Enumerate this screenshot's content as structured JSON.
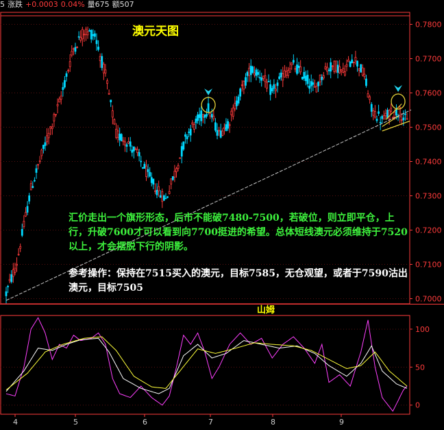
{
  "topbar": {
    "prefix": "5",
    "change_label": "涨跌",
    "change_value": "+0.0003",
    "change_pct": "0.04%",
    "volume": "量675",
    "amount": "额507"
  },
  "chart_data": {
    "type": "candlestick",
    "title": "澳元天图",
    "y_axis": {
      "ticks": [
        0.7,
        0.71,
        0.72,
        0.73,
        0.74,
        0.75,
        0.76,
        0.77,
        0.78
      ],
      "tick_labels": [
        "0.7000",
        "0.7100",
        "0.7200",
        "0.7300",
        "0.7400",
        "0.7500",
        "0.7600",
        "0.7700",
        "0.7800"
      ],
      "ylim": [
        0.6985,
        0.7835
      ]
    },
    "x_axis": {
      "labels": [
        "4",
        "5",
        "6",
        "7",
        "8",
        "9"
      ]
    },
    "price_waypoints": [
      [
        0,
        0.7015
      ],
      [
        6,
        0.7105
      ],
      [
        14,
        0.732
      ],
      [
        22,
        0.745
      ],
      [
        30,
        0.757
      ],
      [
        38,
        0.773
      ],
      [
        44,
        0.778
      ],
      [
        50,
        0.777
      ],
      [
        56,
        0.765
      ],
      [
        62,
        0.748
      ],
      [
        68,
        0.746
      ],
      [
        74,
        0.742
      ],
      [
        80,
        0.736
      ],
      [
        86,
        0.731
      ],
      [
        90,
        0.729
      ],
      [
        96,
        0.738
      ],
      [
        102,
        0.748
      ],
      [
        108,
        0.752
      ],
      [
        114,
        0.7555
      ],
      [
        120,
        0.748
      ],
      [
        126,
        0.752
      ],
      [
        132,
        0.76
      ],
      [
        138,
        0.767
      ],
      [
        144,
        0.765
      ],
      [
        150,
        0.76
      ],
      [
        156,
        0.765
      ],
      [
        162,
        0.768
      ],
      [
        168,
        0.765
      ],
      [
        174,
        0.761
      ],
      [
        180,
        0.767
      ],
      [
        186,
        0.768
      ],
      [
        190,
        0.766
      ],
      [
        196,
        0.7705
      ],
      [
        202,
        0.765
      ],
      [
        206,
        0.755
      ],
      [
        212,
        0.752
      ],
      [
        216,
        0.754
      ],
      [
        222,
        0.7545
      ],
      [
        226,
        0.7515
      ]
    ],
    "trendline": {
      "from": [
        0,
        0.6995
      ],
      "to": [
        226,
        0.7545
      ]
    },
    "resistance_line": {
      "value": 0.7825
    },
    "circles": [
      {
        "index": 114,
        "value": 0.7565,
        "marker": "down-arrow"
      },
      {
        "index": 221,
        "value": 0.7575,
        "marker": "down-arrow"
      }
    ],
    "support_segment": {
      "from": [
        212,
        0.7489
      ],
      "to": [
        226,
        0.7518
      ]
    },
    "flag_lines": [
      {
        "from": [
          212,
          0.7502
        ],
        "to": [
          221,
          0.7532
        ]
      },
      {
        "from": [
          214,
          0.7522
        ],
        "to": [
          223,
          0.7568
        ]
      }
    ],
    "colors": {
      "up": "#ff3b3b",
      "down": "#00d8ff",
      "trendline": "#c8c8c8",
      "circle": "#e6d23a",
      "marker": "#22d3ee",
      "axis": "#ff3b3b"
    }
  },
  "annotations": {
    "analysis_text": "汇价走出一个旗形形态，后市不能破7480-7500，若破位，则立即平仓，上行，升破7600才可以看到向7700挺进的希望。总体短线澳元必须维持于7520以上，才会摆脱下行的阴影。",
    "strategy_text": "参考操作：保持在7515买入的澳元，目标7585，无仓观望，或者于7590沽出澳元，目标7505"
  },
  "indicator": {
    "name": "山姆",
    "y_ticks": [
      0,
      50,
      100
    ],
    "tick_labels": [
      "0",
      "50",
      "100"
    ],
    "ylim": [
      -12,
      118
    ],
    "series": [
      {
        "color": "#ff40ff",
        "waypoints": [
          [
            0,
            15
          ],
          [
            5,
            12
          ],
          [
            10,
            50
          ],
          [
            14,
            100
          ],
          [
            18,
            115
          ],
          [
            22,
            95
          ],
          [
            26,
            60
          ],
          [
            30,
            80
          ],
          [
            34,
            75
          ],
          [
            38,
            92
          ],
          [
            42,
            85
          ],
          [
            48,
            88
          ],
          [
            52,
            95
          ],
          [
            56,
            80
          ],
          [
            60,
            35
          ],
          [
            64,
            15
          ],
          [
            70,
            10
          ],
          [
            76,
            25
          ],
          [
            82,
            10
          ],
          [
            88,
            0
          ],
          [
            92,
            12
          ],
          [
            96,
            50
          ],
          [
            100,
            92
          ],
          [
            104,
            80
          ],
          [
            108,
            95
          ],
          [
            112,
            70
          ],
          [
            116,
            35
          ],
          [
            120,
            50
          ],
          [
            126,
            80
          ],
          [
            132,
            95
          ],
          [
            138,
            80
          ],
          [
            144,
            88
          ],
          [
            150,
            62
          ],
          [
            156,
            80
          ],
          [
            162,
            90
          ],
          [
            168,
            75
          ],
          [
            174,
            55
          ],
          [
            178,
            80
          ],
          [
            182,
            30
          ],
          [
            188,
            40
          ],
          [
            194,
            25
          ],
          [
            200,
            70
          ],
          [
            204,
            112
          ],
          [
            208,
            50
          ],
          [
            212,
            10
          ],
          [
            218,
            -8
          ],
          [
            224,
            20
          ],
          [
            226,
            25
          ]
        ]
      },
      {
        "color": "#ffffff",
        "waypoints": [
          [
            0,
            18
          ],
          [
            10,
            45
          ],
          [
            18,
            75
          ],
          [
            26,
            72
          ],
          [
            34,
            80
          ],
          [
            42,
            86
          ],
          [
            52,
            88
          ],
          [
            58,
            70
          ],
          [
            66,
            35
          ],
          [
            76,
            22
          ],
          [
            86,
            15
          ],
          [
            92,
            22
          ],
          [
            100,
            65
          ],
          [
            108,
            80
          ],
          [
            116,
            62
          ],
          [
            124,
            68
          ],
          [
            134,
            85
          ],
          [
            144,
            80
          ],
          [
            154,
            75
          ],
          [
            164,
            78
          ],
          [
            174,
            68
          ],
          [
            182,
            52
          ],
          [
            192,
            38
          ],
          [
            200,
            55
          ],
          [
            206,
            78
          ],
          [
            212,
            45
          ],
          [
            220,
            28
          ],
          [
            226,
            22
          ]
        ]
      },
      {
        "color": "#ffff3a",
        "waypoints": [
          [
            0,
            20
          ],
          [
            12,
            42
          ],
          [
            22,
            70
          ],
          [
            32,
            80
          ],
          [
            44,
            88
          ],
          [
            54,
            90
          ],
          [
            62,
            72
          ],
          [
            72,
            38
          ],
          [
            82,
            24
          ],
          [
            90,
            22
          ],
          [
            98,
            45
          ],
          [
            108,
            74
          ],
          [
            118,
            68
          ],
          [
            128,
            74
          ],
          [
            140,
            82
          ],
          [
            150,
            80
          ],
          [
            162,
            78
          ],
          [
            172,
            72
          ],
          [
            182,
            60
          ],
          [
            192,
            48
          ],
          [
            200,
            52
          ],
          [
            208,
            70
          ],
          [
            216,
            45
          ],
          [
            226,
            25
          ]
        ]
      }
    ]
  }
}
